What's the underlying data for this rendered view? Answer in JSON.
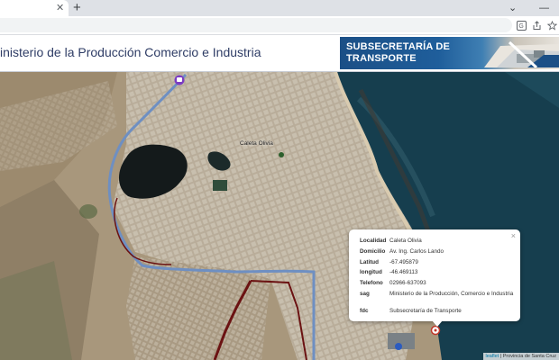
{
  "browser": {
    "tab_close": "✕",
    "new_tab": "+",
    "win_minimize": "⌄",
    "win_restore": "—"
  },
  "header": {
    "ministry_title": "inisterio de la Producción Comercio e Industria",
    "banner_line1": "SUBSECRETARÍA DE",
    "banner_line2": "TRANSPORTE"
  },
  "map": {
    "city_label": "Caleta Olivia",
    "attribution_link": "leaflet",
    "attribution_text": " | Provincia de Santa Cruz"
  },
  "popup": {
    "close": "×",
    "rows": [
      {
        "key": "Localidad",
        "value": "Caleta Olivia"
      },
      {
        "key": "Domicilio",
        "value": "Av. Ing. Carlos Lando"
      },
      {
        "key": "Latitud",
        "value": "-67.495879"
      },
      {
        "key": "longitud",
        "value": "-46.469113"
      },
      {
        "key": "Telefono",
        "value": "02966-637093"
      },
      {
        "key": "sag",
        "value": "Ministerio de la Producción, Comercio e Industria"
      },
      {
        "key": "fdc",
        "value": "Subsecretaría de Transporte"
      }
    ]
  },
  "colors": {
    "sea": "#163e4e",
    "route_blue": "#6e8fc2",
    "route_darkred": "#6b1212",
    "banner_blue": "#1b4f86"
  }
}
